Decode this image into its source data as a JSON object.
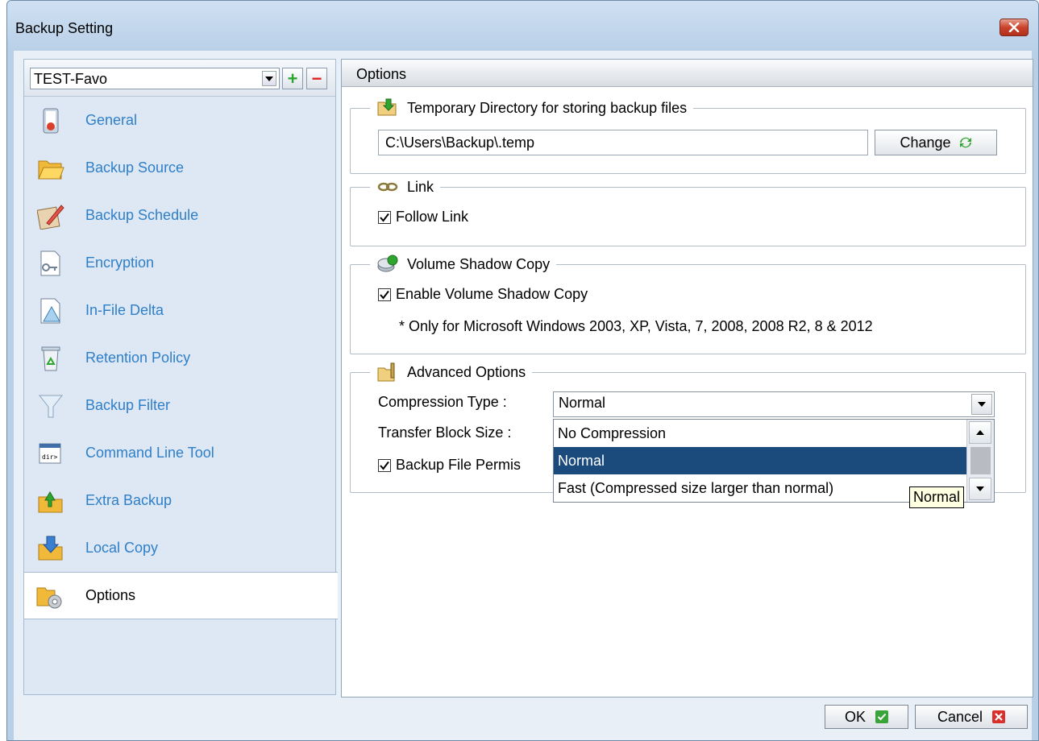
{
  "window": {
    "title": "Backup Setting",
    "close_icon": "close-icon"
  },
  "profile": {
    "selected": "TEST-Favo",
    "add_label": "+",
    "remove_label": "−"
  },
  "sidebar": {
    "items": [
      {
        "label": "General",
        "icon": "general-icon"
      },
      {
        "label": "Backup Source",
        "icon": "folder-icon"
      },
      {
        "label": "Backup Schedule",
        "icon": "schedule-icon"
      },
      {
        "label": "Encryption",
        "icon": "key-icon"
      },
      {
        "label": "In-File Delta",
        "icon": "delta-icon"
      },
      {
        "label": "Retention Policy",
        "icon": "recycle-icon"
      },
      {
        "label": "Backup Filter",
        "icon": "filter-icon"
      },
      {
        "label": "Command Line Tool",
        "icon": "terminal-icon"
      },
      {
        "label": "Extra Backup",
        "icon": "extra-backup-icon"
      },
      {
        "label": "Local Copy",
        "icon": "local-copy-icon"
      },
      {
        "label": "Options",
        "icon": "options-icon"
      }
    ],
    "active": "Options"
  },
  "panel": {
    "title": "Options"
  },
  "temp_dir": {
    "legend": "Temporary Directory for storing backup files",
    "value": "C:\\Users\\Backup\\.temp",
    "change_label": "Change"
  },
  "link": {
    "legend": "Link",
    "follow_label": "Follow Link",
    "follow_checked": true
  },
  "vss": {
    "legend": "Volume Shadow Copy",
    "enable_label": "Enable Volume Shadow Copy",
    "enable_checked": true,
    "note": "* Only for Microsoft Windows 2003, XP, Vista, 7, 2008, 2008 R2, 8 & 2012"
  },
  "advanced": {
    "legend": "Advanced Options",
    "compression_label": "Compression Type :",
    "compression_value": "Normal",
    "transfer_label": "Transfer Block Size :",
    "permission_label": "Backup File Permis",
    "permission_checked": true,
    "dropdown_options": [
      "No Compression",
      "Normal",
      "Fast (Compressed size larger than normal)"
    ],
    "dropdown_selected": "Normal",
    "tooltip": "Normal"
  },
  "footer": {
    "ok_label": "OK",
    "cancel_label": "Cancel"
  },
  "colors": {
    "link_blue": "#2f7fc8",
    "selection_blue": "#1b4a7d",
    "ok_green": "#3aa33a",
    "cancel_red": "#d9302c"
  }
}
